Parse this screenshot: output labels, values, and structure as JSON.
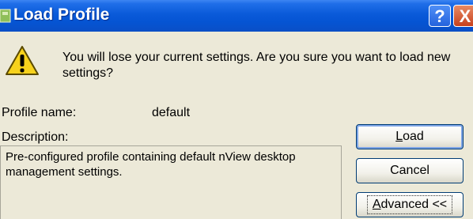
{
  "window": {
    "title": "Load Profile",
    "help_glyph": "?",
    "close_glyph": "X"
  },
  "message": "You will lose your current settings. Are you sure you want to load new settings?",
  "profile": {
    "name_label": "Profile name:",
    "name_value": "default",
    "description_label": "Description:",
    "description_value": "Pre-configured profile containing default nView desktop management settings."
  },
  "buttons": {
    "load_mnemonic": "L",
    "load_rest": "oad",
    "cancel": "Cancel",
    "advanced_mnemonic": "A",
    "advanced_rest": "dvanced <<"
  },
  "icons": {
    "warning": "warning-icon",
    "app": "app-icon",
    "help": "help-icon",
    "close": "close-icon"
  },
  "colors": {
    "titlebar": "#0a5ad9",
    "dialog_bg": "#ece9d8",
    "warning_yellow": "#f7d21c"
  }
}
